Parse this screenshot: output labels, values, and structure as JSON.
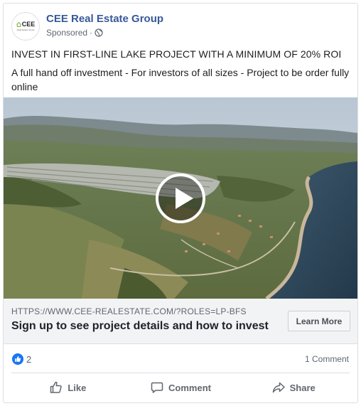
{
  "post": {
    "page_name": "CEE Real Estate Group",
    "sponsored_label": "Sponsored",
    "separator": "·",
    "avatar": {
      "logo_text": "CEE",
      "logo_subtext": "Real Estate Group"
    },
    "headline": "INVEST IN FIRST-LINE LAKE PROJECT WITH A MINIMUM OF 20% ROI",
    "body": "A full hand off investment - For investors of all sizes - Project to be order fully online"
  },
  "media": {
    "type": "video",
    "icon": "play-icon"
  },
  "link": {
    "url": "HTTPS://WWW.CEE-REALESTATE.COM/?ROLES=LP-BFS",
    "title": "Sign up to see project details and how to invest",
    "cta_label": "Learn More"
  },
  "engagement": {
    "like_count": "2",
    "comment_count": "1 Comment"
  },
  "actions": {
    "like_label": "Like",
    "comment_label": "Comment",
    "share_label": "Share"
  },
  "colors": {
    "page_name": "#385898",
    "like_blue": "#1877f2",
    "link_area_bg": "#f2f3f5",
    "secondary_text": "#606770"
  }
}
